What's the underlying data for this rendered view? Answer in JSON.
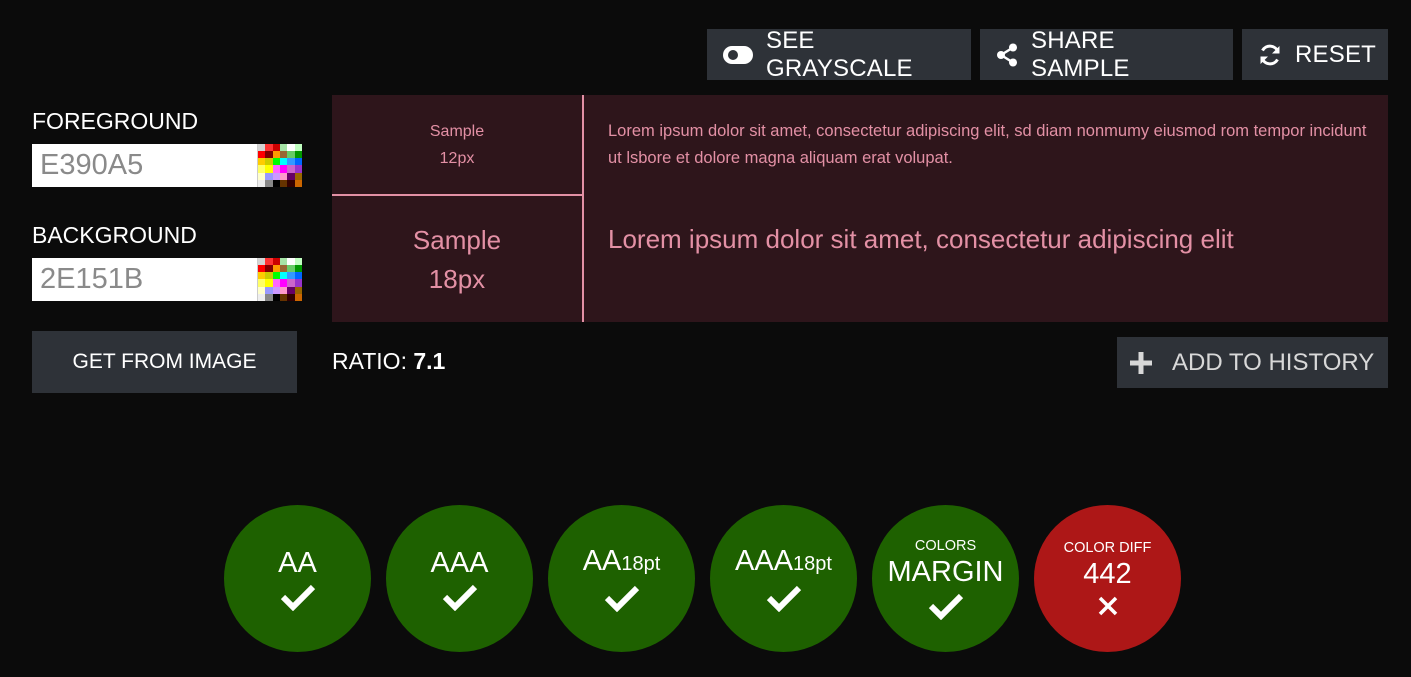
{
  "toolbar": {
    "grayscale_label": "SEE GRAYSCALE",
    "share_label": "SHARE SAMPLE",
    "reset_label": "RESET",
    "grayscale_icon": "toggle-icon",
    "share_icon": "share-icon",
    "reset_icon": "refresh-icon"
  },
  "foreground": {
    "label": "FOREGROUND",
    "value": "E390A5",
    "color": "#e390a5"
  },
  "background": {
    "label": "BACKGROUND",
    "value": "2E151B",
    "color": "#2e151b"
  },
  "get_from_image_label": "GET FROM IMAGE",
  "sample": {
    "small_label_line1": "Sample",
    "small_label_line2": "12px",
    "large_label_line1": "Sample",
    "large_label_line2": "18px",
    "small_text": "Lorem ipsum dolor sit amet, consectetur adipiscing elit, sd diam nonmumy eiusmod rom tempor incidunt ut lsbore et dolore magna aliquam erat volupat.",
    "large_text": "Lorem ipsum dolor sit amet, consectetur adipiscing elit"
  },
  "ratio": {
    "label": "RATIO:",
    "value": "7.1"
  },
  "add_history": {
    "label": "ADD TO HISTORY",
    "icon": "plus-icon"
  },
  "results": {
    "aa": {
      "main": "AA",
      "status": "pass"
    },
    "aaa": {
      "main": "AAA",
      "status": "pass"
    },
    "aa18": {
      "main": "AA",
      "sub": "18pt",
      "status": "pass"
    },
    "aaa18": {
      "main": "AAA",
      "sub": "18pt",
      "status": "pass"
    },
    "margin": {
      "top": "COLORS",
      "main": "MARGIN",
      "status": "pass"
    },
    "diff": {
      "top": "COLOR DIFF",
      "main": "442",
      "status": "fail"
    }
  },
  "colors": {
    "pass": "#1e6100",
    "fail": "#ad1717",
    "button": "#2e3238"
  }
}
